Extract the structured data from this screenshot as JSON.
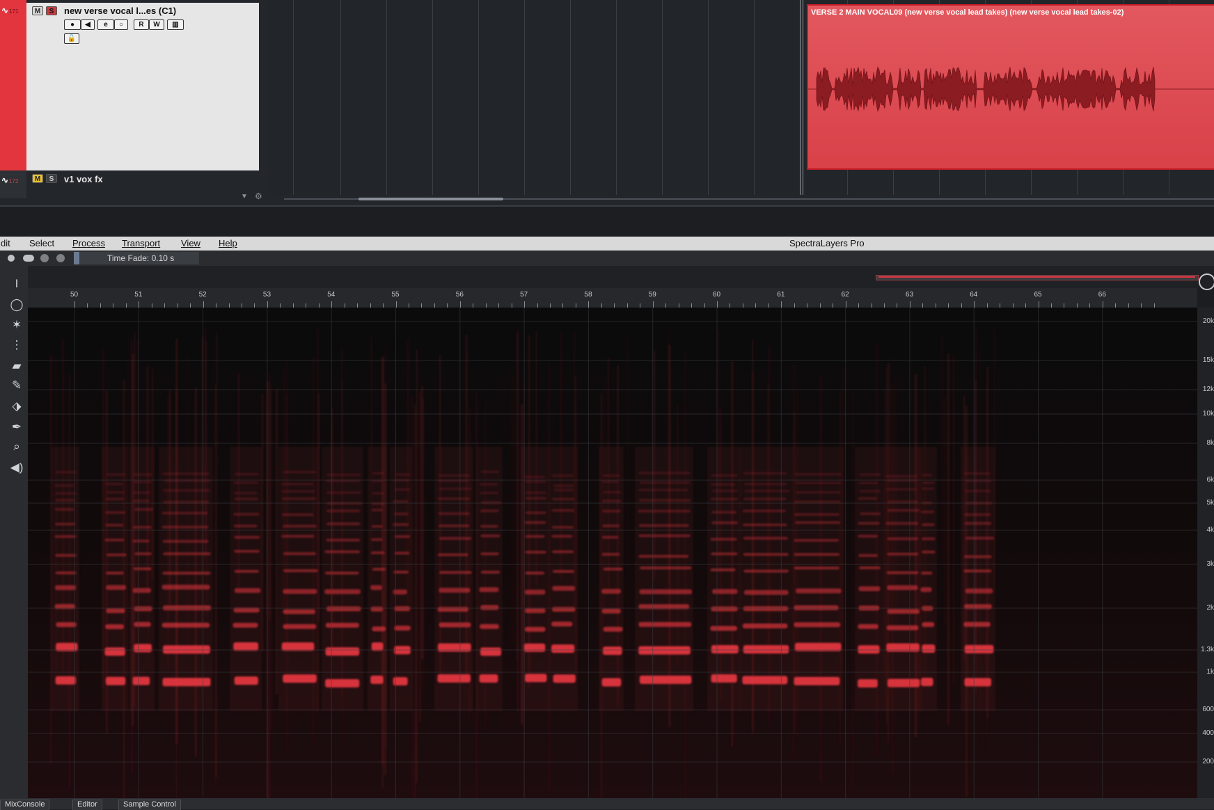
{
  "tracks": [
    {
      "number": "171",
      "mute": "M",
      "solo": "S",
      "name": "new verse vocal l...es (C1)"
    },
    {
      "number": "172",
      "mute": "M",
      "solo": "S",
      "name": "v1 vox fx"
    }
  ],
  "track_controls": {
    "record": "●",
    "monitor": "◀",
    "edit": "e",
    "automation": "○",
    "read": "R",
    "write": "W",
    "lanes": "▥",
    "lock": "🔓"
  },
  "event": {
    "title": "VERSE 2 MAIN VOCAL09 (new verse vocal lead takes) (new verse vocal lead takes-02)",
    "color": "#e2353d"
  },
  "menu": {
    "items": [
      "dit",
      "Select",
      "Process",
      "Transport",
      "View",
      "Help"
    ],
    "app_title": "SpectraLayers Pro"
  },
  "toolbar": {
    "time_fade": "Time Fade: 0.10 s"
  },
  "ruler": {
    "labels": [
      "50",
      "51",
      "52",
      "53",
      "54",
      "55",
      "56",
      "57",
      "58",
      "59",
      "60",
      "61",
      "62",
      "63",
      "64",
      "65",
      "66"
    ]
  },
  "freq_axis": {
    "labels": [
      "20k",
      "15k",
      "12k",
      "10k",
      "8k",
      "6k",
      "5k",
      "4k",
      "3k",
      "2k",
      "1.3k",
      "1k",
      "600",
      "400",
      "200"
    ]
  },
  "tools": [
    "select-icon",
    "lasso-icon",
    "magic-wand-icon",
    "eraser-icon",
    "brush-icon",
    "clone-icon",
    "dropper-icon",
    "zoom-icon",
    "speaker-icon"
  ],
  "bottom_tabs": [
    "MixConsole",
    "Editor",
    "Sample Control"
  ],
  "colors": {
    "accent": "#e2353d",
    "spectrum": "#e0353e"
  }
}
